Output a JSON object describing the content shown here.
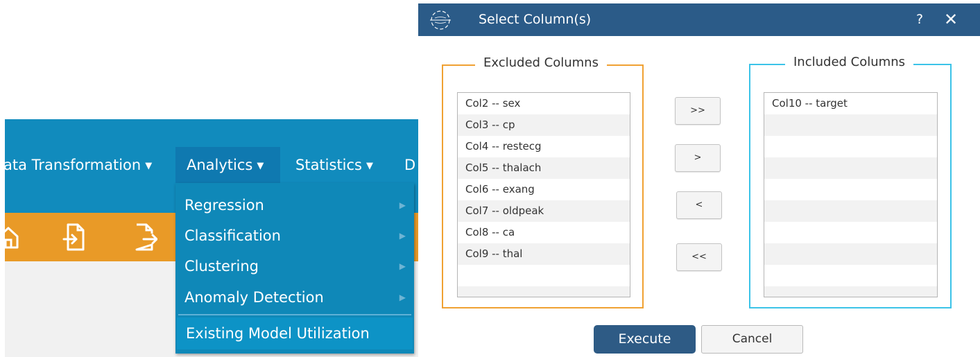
{
  "menubar": {
    "items": [
      {
        "label": "ata Transformation",
        "icon": "caret-down"
      },
      {
        "label": "Analytics",
        "icon": "caret-down"
      },
      {
        "label": "Statistics",
        "icon": "caret-down"
      },
      {
        "label": "D"
      }
    ],
    "caret": "▼"
  },
  "toolbar": {
    "icons": [
      "home-icon",
      "import-icon",
      "export-icon"
    ],
    "background": "#e99a27"
  },
  "analytics_menu": {
    "items": [
      {
        "label": "Regression",
        "has_submenu": true
      },
      {
        "label": "Classification",
        "has_submenu": true
      },
      {
        "label": "Clustering",
        "has_submenu": true
      },
      {
        "label": "Anomaly Detection",
        "has_submenu": true
      },
      {
        "label": "Existing Model Utilization",
        "has_submenu": false
      }
    ],
    "submenu_arrow": "▶"
  },
  "dialog": {
    "title": "Select Column(s)",
    "help": "?",
    "close": "✕",
    "excluded": {
      "label": "Excluded Columns",
      "items": [
        "Col2 -- sex",
        "Col3 -- cp",
        "Col4 -- restecg",
        "Col5 -- thalach",
        "Col6 -- exang",
        "Col7 -- oldpeak",
        "Col8 -- ca",
        "Col9 -- thal"
      ]
    },
    "included": {
      "label": "Included Columns",
      "items": [
        "Col10 -- target"
      ]
    },
    "move_buttons": {
      "add_all": ">>",
      "add": ">",
      "remove": "<",
      "remove_all": "<<"
    },
    "execute": "Execute",
    "cancel": "Cancel"
  },
  "colors": {
    "menubar": "#118bbd",
    "dropdown": "#0f88b8",
    "titlebar": "#2b5b88",
    "excluded_border": "#f0a132",
    "included_border": "#3bc3e8",
    "execute_button": "#2e5b85"
  }
}
